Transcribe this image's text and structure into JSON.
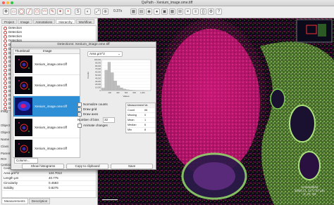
{
  "window": {
    "title": "QuPath - Xenium_image.ome.tiff"
  },
  "toolbar": {
    "zoom": "0.37x"
  },
  "left": {
    "tabs": [
      "Project",
      "Image",
      "Annotations",
      "Hierarchy",
      "Workflow"
    ],
    "objects": [
      "Detection",
      "Detection",
      "Detection",
      "Detection",
      "Detection",
      "Detection",
      "Detection",
      "Detection",
      "Detection",
      "Detection",
      "Detection",
      "Detection",
      "Detection",
      "Detection",
      "Detection",
      "Detection",
      "Detection",
      "Detection",
      "Detection",
      "Detection"
    ],
    "side_labels": [
      "Imag",
      "Object",
      "Object",
      "Name",
      "Class",
      "Parent",
      "ROI",
      "Centroid"
    ],
    "properties": [
      {
        "key": "Centroid Y µm",
        "value": "4.7668"
      },
      {
        "key": "Area µm^2",
        "value": "124.7013"
      },
      {
        "key": "Length µm",
        "value": "40.775"
      },
      {
        "key": "Circularity",
        "value": "0.4583"
      },
      {
        "key": "Solidity",
        "value": "0.8275"
      }
    ],
    "bottom_tabs": [
      "Measurements",
      "Description"
    ]
  },
  "dialog": {
    "title": "Detections: Xenium_image.ome.tiff",
    "col_thumb": "Thumbnail",
    "col_image": "Image",
    "rows": [
      "Xenium_image.ome.tiff",
      "Xenium_image.ome.tiff",
      "Xenium_image.ome.tiff",
      "Xenium_image.ome.tiff",
      "Xenium_image.ome.tiff"
    ],
    "selected_row": 2,
    "column_select": "Column...",
    "measurement_select": "Area µm^2",
    "normalize": "Normalize counts",
    "draw_grid": "Draw grid",
    "draw_axes": "Draw axes",
    "bins_label": "Number of bins",
    "bins_value": "32",
    "animate": "Animate changes",
    "stats_header": [
      "Measurement",
      "Va"
    ],
    "stats": [
      {
        "key": "Count",
        "value": "66"
      },
      {
        "key": "Missing",
        "value": "0"
      },
      {
        "key": "Mean",
        "value": "1"
      },
      {
        "key": "Median",
        "value": "6"
      },
      {
        "key": "Min",
        "value": "8"
      },
      {
        "key": "Max",
        "value": "1"
      }
    ],
    "btn_show": "Show histograms",
    "btn_copy": "Copy to clipboard",
    "btn_save": "Save"
  },
  "chart_data": {
    "type": "bar",
    "title": "",
    "xlabel": "Values",
    "ylabel": "Counts",
    "ylim": [
      0,
      100000
    ],
    "yticks": [
      "100,000",
      "90,000",
      "80,000",
      "70,000",
      "60,000",
      "50,000",
      "40,000",
      "30,000",
      "20,000",
      "10,000",
      "0"
    ],
    "xticks": [
      "200",
      "400",
      "600",
      "800",
      "1,000"
    ],
    "values": [
      8000,
      66000,
      92000,
      58000,
      31000,
      16000,
      9000,
      5000,
      3000,
      2000,
      1200,
      800,
      500,
      300,
      200,
      100
    ]
  },
  "viewer": {
    "overlay_lines": [
      "Unclassified",
      "2048.72, 1277.07 µm",
      "0, 27, 49"
    ]
  },
  "colors": {
    "selection": "#2f8fd6",
    "detection_ring": "#d12d2d",
    "magenta": "#d6197a",
    "green": "#7ac043"
  }
}
